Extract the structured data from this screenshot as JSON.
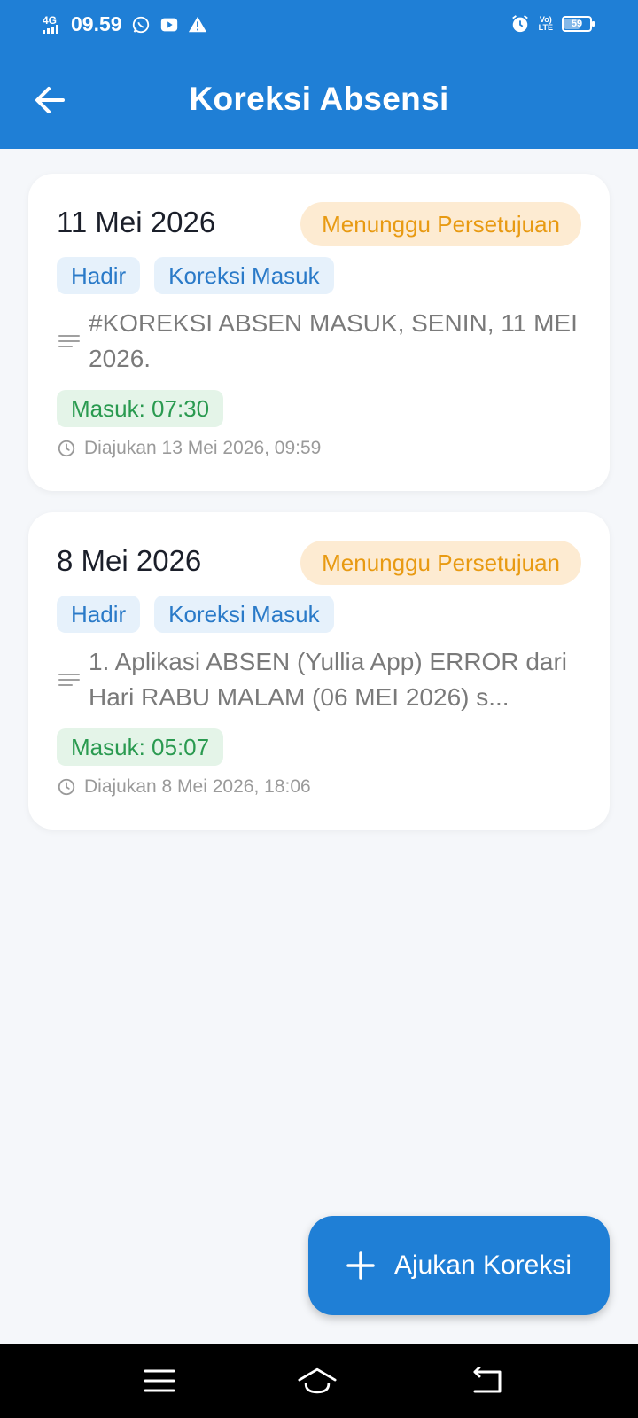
{
  "status_bar": {
    "network": "4G",
    "time": "09.59",
    "battery": "59",
    "volte_top": "Vo)",
    "volte_bottom": "LTE"
  },
  "app_bar": {
    "title": "Koreksi Absensi"
  },
  "cards": [
    {
      "date": "11 Mei 2026",
      "status": "Menunggu Persetujuan",
      "tags": [
        "Hadir",
        "Koreksi Masuk"
      ],
      "note": "#KOREKSI ABSEN MASUK, SENIN, 11 MEI 2026.",
      "masuk": "Masuk: 07:30",
      "submitted": "Diajukan 13 Mei 2026, 09:59"
    },
    {
      "date": "8 Mei 2026",
      "status": "Menunggu Persetujuan",
      "tags": [
        "Hadir",
        "Koreksi Masuk"
      ],
      "note": "1. Aplikasi ABSEN (Yullia App) ERROR dari Hari RABU MALAM (06 MEI 2026) s...",
      "masuk": "Masuk: 05:07",
      "submitted": "Diajukan 8 Mei 2026, 18:06"
    }
  ],
  "fab": {
    "label": "Ajukan Koreksi",
    "icon": "plus-icon"
  },
  "colors": {
    "primary": "#1f7fd6",
    "pending_bg": "#fdebd2",
    "pending_text": "#e89a12",
    "tag_bg": "#e6f1fb",
    "tag_text": "#2a7ac8",
    "masuk_bg": "#e4f4e8",
    "masuk_text": "#2a9a50"
  },
  "nav": {
    "icons": [
      "menu-icon",
      "home-icon",
      "back-icon"
    ]
  }
}
